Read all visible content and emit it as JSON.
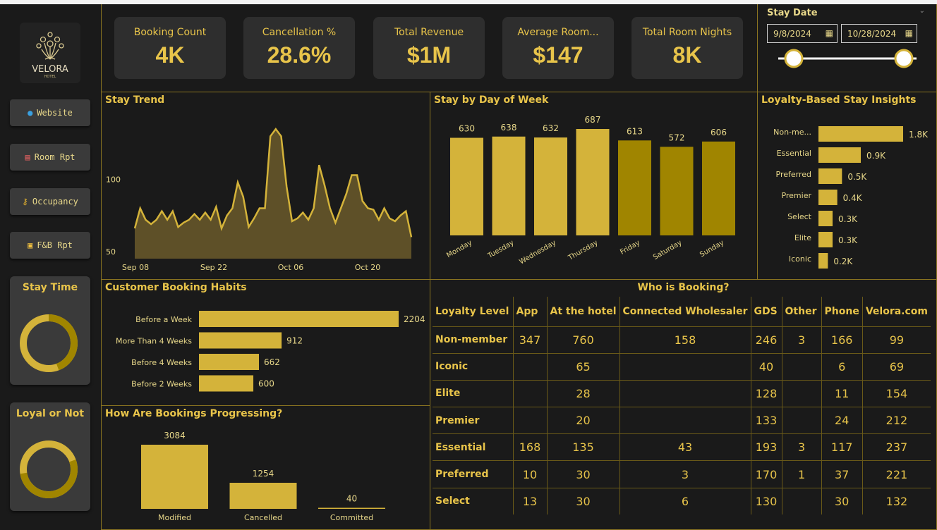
{
  "nav": {
    "website": "Website",
    "room_rpt": "Room Rpt",
    "occupancy": "Occupancy",
    "fb_rpt": "F&B Rpt",
    "stay_time": "Stay Time",
    "loyal_or_not": "Loyal or Not"
  },
  "brand": {
    "name": "VELORA",
    "sub": "HOTEL"
  },
  "kpis": [
    {
      "label": "Booking Count",
      "value": "4K"
    },
    {
      "label": "Cancellation %",
      "value": "28.6%"
    },
    {
      "label": "Total Revenue",
      "value": "$1M"
    },
    {
      "label": "Average Room...",
      "value": "$147"
    },
    {
      "label": "Total Room Nights",
      "value": "8K"
    }
  ],
  "stay_date": {
    "title": "Stay Date",
    "start": "9/8/2024",
    "end": "10/28/2024"
  },
  "colors": {
    "gold": "#e8c44a",
    "bar_gold": "#d4b33a",
    "dark_gold": "#a08500",
    "area": "#5e5028"
  },
  "titles": {
    "stay_trend": "Stay Trend",
    "stay_dow": "Stay by Day of Week",
    "loyalty": "Loyalty-Based Stay Insights",
    "habits": "Customer Booking Habits",
    "progress": "How Are Bookings Progressing?",
    "who": "Who is Booking?"
  },
  "chart_data": [
    {
      "type": "area",
      "title": "Stay Trend",
      "x_ticks": [
        "Sep 08",
        "Sep 22",
        "Oct 06",
        "Oct 20"
      ],
      "y_ticks": [
        50,
        100
      ],
      "values": [
        66,
        80,
        72,
        69,
        72,
        78,
        72,
        78,
        67,
        70,
        72,
        76,
        72,
        77,
        72,
        81,
        66,
        75,
        80,
        98,
        88,
        67,
        73,
        80,
        80,
        130,
        135,
        130,
        95,
        71,
        73,
        77,
        72,
        80,
        110,
        96,
        80,
        70,
        80,
        90,
        103,
        103,
        85,
        80,
        79,
        72,
        80,
        73,
        71,
        75,
        78,
        60
      ]
    },
    {
      "type": "bar",
      "title": "Stay by Day of Week",
      "categories": [
        "Monday",
        "Tuesday",
        "Wednesday",
        "Thursday",
        "Friday",
        "Saturday",
        "Sunday"
      ],
      "values": [
        630,
        638,
        632,
        687,
        613,
        572,
        606
      ]
    },
    {
      "type": "bar",
      "title": "Loyalty-Based Stay Insights",
      "categories": [
        "Non-me...",
        "Essential",
        "Preferred",
        "Premier",
        "Select",
        "Elite",
        "Iconic"
      ],
      "values": [
        1.8,
        0.9,
        0.5,
        0.4,
        0.3,
        0.3,
        0.2
      ],
      "labels": [
        "1.8K",
        "0.9K",
        "0.5K",
        "0.4K",
        "0.3K",
        "0.3K",
        "0.2K"
      ]
    },
    {
      "type": "bar",
      "title": "Customer Booking Habits",
      "categories": [
        "Before a Week",
        "More Than 4 Weeks",
        "Before 4 Weeks",
        "Before 2 Weeks"
      ],
      "values": [
        2204,
        912,
        662,
        600
      ]
    },
    {
      "type": "bar",
      "title": "How Are Bookings Progressing?",
      "categories": [
        "Modified",
        "Cancelled",
        "Committed"
      ],
      "values": [
        3084,
        1254,
        40
      ]
    },
    {
      "type": "table",
      "title": "Who is Booking?",
      "columns": [
        "Loyalty Level",
        "App",
        "At the hotel",
        "Connected Wholesaler",
        "GDS",
        "Other",
        "Phone",
        "Velora.com"
      ],
      "rows": [
        [
          "Non-member",
          "347",
          "760",
          "158",
          "246",
          "3",
          "166",
          "99"
        ],
        [
          "Iconic",
          "",
          "65",
          "",
          "40",
          "",
          "6",
          "69"
        ],
        [
          "Elite",
          "",
          "28",
          "",
          "128",
          "",
          "11",
          "154"
        ],
        [
          "Premier",
          "",
          "20",
          "",
          "133",
          "",
          "24",
          "212"
        ],
        [
          "Essential",
          "168",
          "135",
          "43",
          "193",
          "3",
          "117",
          "237"
        ],
        [
          "Preferred",
          "10",
          "30",
          "3",
          "170",
          "1",
          "37",
          "221"
        ],
        [
          "Select",
          "13",
          "30",
          "6",
          "130",
          "",
          "30",
          "132"
        ]
      ]
    }
  ]
}
